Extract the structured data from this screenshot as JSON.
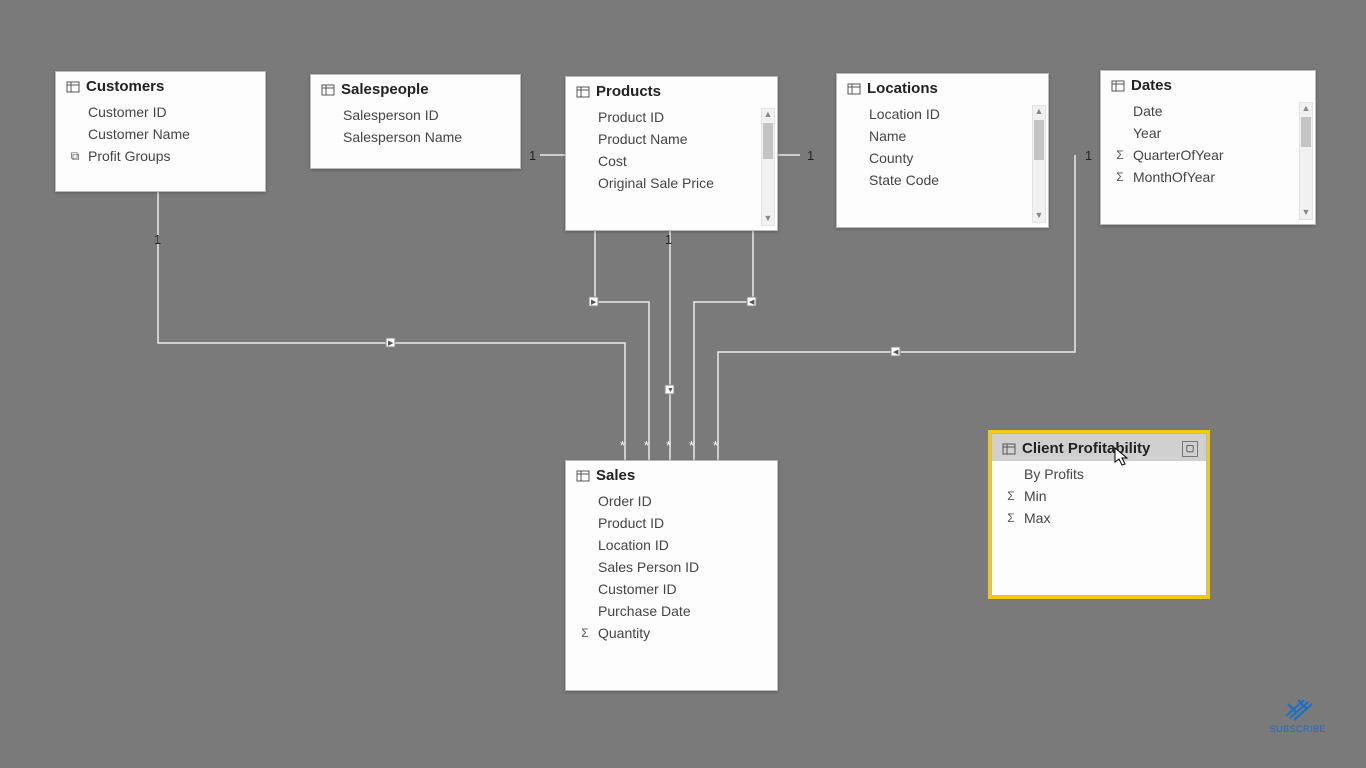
{
  "tables": {
    "customers": {
      "title": "Customers",
      "fields": [
        {
          "label": "Customer ID",
          "icon": ""
        },
        {
          "label": "Customer Name",
          "icon": ""
        },
        {
          "label": "Profit Groups",
          "icon": "group"
        }
      ]
    },
    "salespeople": {
      "title": "Salespeople",
      "fields": [
        {
          "label": "Salesperson ID",
          "icon": ""
        },
        {
          "label": "Salesperson Name",
          "icon": ""
        }
      ]
    },
    "products": {
      "title": "Products",
      "fields": [
        {
          "label": "Product ID",
          "icon": ""
        },
        {
          "label": "Product Name",
          "icon": ""
        },
        {
          "label": "Cost",
          "icon": ""
        },
        {
          "label": "Original Sale Price",
          "icon": ""
        }
      ]
    },
    "locations": {
      "title": "Locations",
      "fields": [
        {
          "label": "Location ID",
          "icon": ""
        },
        {
          "label": "Name",
          "icon": ""
        },
        {
          "label": "County",
          "icon": ""
        },
        {
          "label": "State Code",
          "icon": ""
        }
      ]
    },
    "dates": {
      "title": "Dates",
      "fields": [
        {
          "label": "Date",
          "icon": ""
        },
        {
          "label": "Year",
          "icon": ""
        },
        {
          "label": "QuarterOfYear",
          "icon": "sigma"
        },
        {
          "label": "MonthOfYear",
          "icon": "sigma"
        }
      ]
    },
    "sales": {
      "title": "Sales",
      "fields": [
        {
          "label": "Order ID",
          "icon": ""
        },
        {
          "label": "Product ID",
          "icon": ""
        },
        {
          "label": "Location ID",
          "icon": ""
        },
        {
          "label": "Sales Person ID",
          "icon": ""
        },
        {
          "label": "Customer ID",
          "icon": ""
        },
        {
          "label": "Purchase Date",
          "icon": ""
        },
        {
          "label": "Quantity",
          "icon": "sigma"
        }
      ]
    },
    "client_profitability": {
      "title": "Client Profitability",
      "fields": [
        {
          "label": "By Profits",
          "icon": ""
        },
        {
          "label": "Min",
          "icon": "sigma"
        },
        {
          "label": "Max",
          "icon": "sigma"
        }
      ]
    }
  },
  "relationship_labels": {
    "customers": "1",
    "salespeople": "1",
    "products": "1",
    "locations": "1",
    "dates": "1",
    "sales_many": "*"
  },
  "subscribe_label": "SUBSCRIBE"
}
